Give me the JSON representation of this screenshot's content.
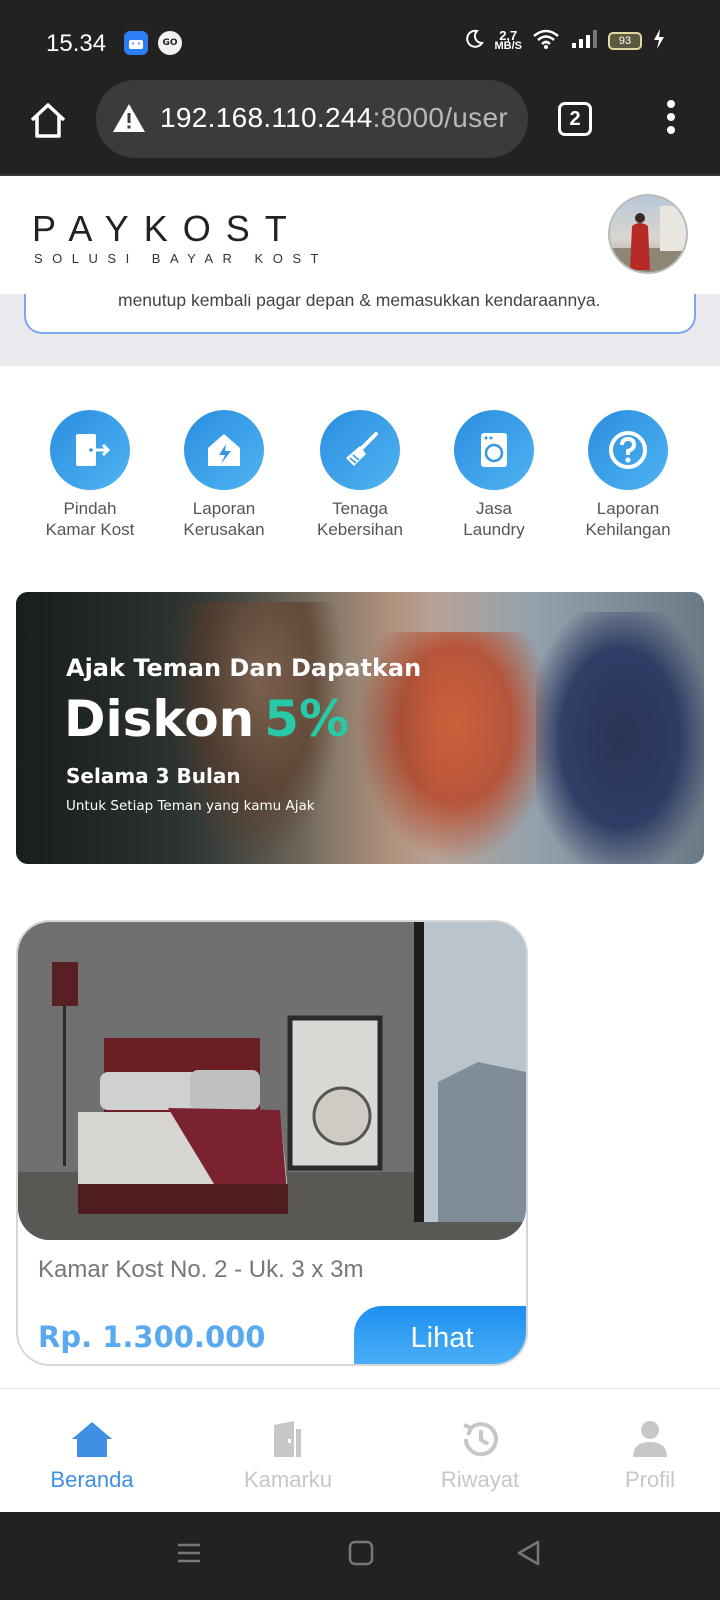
{
  "status_bar": {
    "time": "15.34",
    "app_badge": "GO",
    "net_speed_value": "2,7",
    "net_speed_unit": "MB/S",
    "battery": "93"
  },
  "browser": {
    "url_host": "192.168.110.244",
    "url_rest": ":8000/user",
    "tab_count": "2"
  },
  "header": {
    "logo_title": "PAYKOST",
    "logo_subtitle": "SOLUSI BAYAR KOST"
  },
  "notice": {
    "text": "menutup kembali pagar depan & memasukkan kendaraannya."
  },
  "services": [
    {
      "label_line1": "Pindah",
      "label_line2": "Kamar Kost",
      "icon": "door-exit-icon"
    },
    {
      "label_line1": "Laporan",
      "label_line2": "Kerusakan",
      "icon": "house-damage-icon"
    },
    {
      "label_line1": "Tenaga",
      "label_line2": "Kebersihan",
      "icon": "broom-icon"
    },
    {
      "label_line1": "Jasa",
      "label_line2": "Laundry",
      "icon": "washing-machine-icon"
    },
    {
      "label_line1": "Laporan",
      "label_line2": "Kehilangan",
      "icon": "question-icon"
    }
  ],
  "banner": {
    "line1": "Ajak Teman Dan Dapatkan",
    "discount_word": "Diskon",
    "discount_value": "5%",
    "line3": "Selama 3 Bulan",
    "line4": "Untuk Setiap Teman yang kamu Ajak"
  },
  "room": {
    "title": "Kamar Kost No. 2 - Uk. 3 x 3m",
    "price": "Rp. 1.300.000",
    "button": "Lihat"
  },
  "bottom_nav": [
    {
      "label": "Beranda",
      "icon": "home-icon",
      "active": true
    },
    {
      "label": "Kamarku",
      "icon": "room-door-icon",
      "active": false
    },
    {
      "label": "Riwayat",
      "icon": "history-icon",
      "active": false
    },
    {
      "label": "Profil",
      "icon": "user-icon",
      "active": false
    }
  ],
  "colors": {
    "accent": "#3d8fe3",
    "nav_active": "#3f8fe5",
    "nav_inactive": "#c7c7c7",
    "discount": "#27c9a6",
    "price": "#58a9ef"
  }
}
